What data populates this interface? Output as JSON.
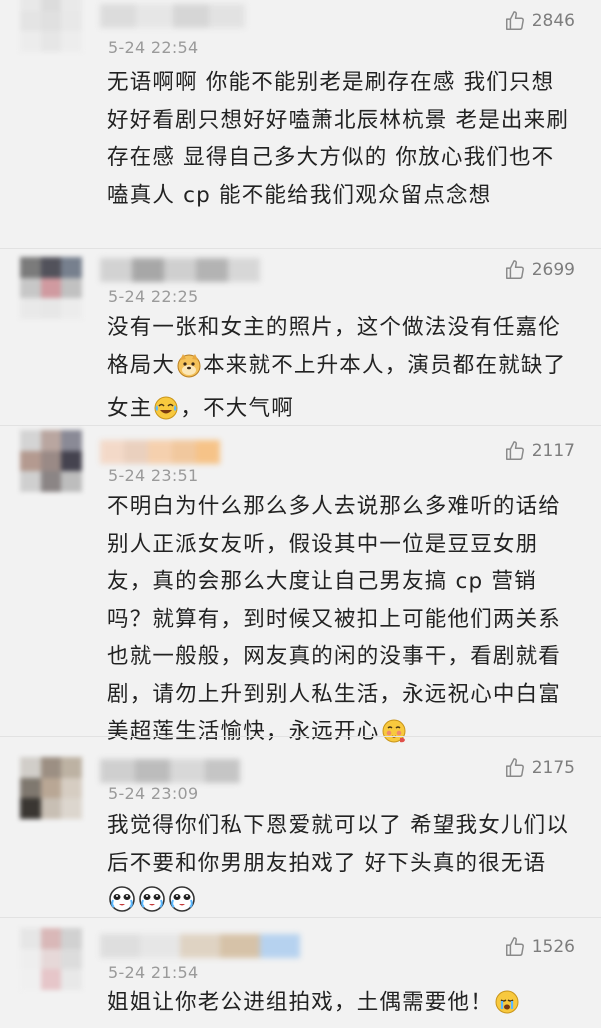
{
  "comments": [
    {
      "time": "5-24 22:54",
      "likes": "2846",
      "text": "无语啊啊 你能不能别老是刷存在感  我们只想好好看剧只想好好嗑萧北辰林杭景 老是出来刷存在感 显得自己多大方似的 你放心我们也不嗑真人 cp  能不能给我们观众留点念想",
      "avatar_colors": [
        "#e8e8e8",
        "#dcdcdc",
        "#e9e9e9",
        "#e4e4e4",
        "#e0e0e0",
        "#e8e8e8",
        "#ececec",
        "#e6e6e6",
        "#ededed"
      ],
      "name_colors": [
        "#dcdcdc",
        "#e6e6e6",
        "#d6d6d6",
        "#e2e2e2"
      ]
    },
    {
      "time": "5-24 22:25",
      "likes": "2699",
      "text_parts": [
        "没有一张和女主的照片，这个做法没有任嘉伦格局大",
        "本来就不上升本人，演员都在就缺了女主",
        "，不大气啊"
      ],
      "avatar_colors": [
        "#7b7b7b",
        "#52525b",
        "#77808e",
        "#c7c7c7",
        "#d09aa0",
        "#c1c1c1",
        "#e9e9e9",
        "#e7e7e7",
        "#ececec"
      ],
      "name_colors": [
        "#d2d2d2",
        "#a7a7a7",
        "#cfcfcf",
        "#b3b3b3",
        "#d7d7d7"
      ]
    },
    {
      "time": "5-24 23:51",
      "likes": "2117",
      "text_parts": [
        "不明白为什么那么多人去说那么多难听的话给别人正派女友听，假设其中一位是豆豆女朋友，真的会那么大度让自己男友搞 cp 营销吗？就算有，到时候又被扣上可能他们两关系也就一般般，网友真的闲的没事干，看剧就看剧，请勿上升到别人私生活，永远祝心中白富美超莲生活愉快，永远开心"
      ],
      "avatar_colors": [
        "#d4d4d4",
        "#b9a6a0",
        "#8a8a96",
        "#b49a90",
        "#9a8a86",
        "#45434f",
        "#cfcfcf",
        "#8b8585",
        "#bdbdbd"
      ],
      "name_colors": [
        "#f3d9c8",
        "#ead0be",
        "#f5d0ae",
        "#f1c89e",
        "#f6c388"
      ]
    },
    {
      "time": "5-24 23:09",
      "likes": "2175",
      "text": "我觉得你们私下恩爱就可以了 希望我女儿们以后不要和你男朋友拍戏了 好下头真的很无语",
      "avatar_colors": [
        "#d1cec9",
        "#9c8f83",
        "#bdb2a3",
        "#7f786f",
        "#b9a795",
        "#d6cdc2",
        "#3a3632",
        "#c8bfb4",
        "#dcd6ce"
      ],
      "name_colors": [
        "#cfcfcf",
        "#bcbcbc",
        "#d8d8d8",
        "#c5c5c5"
      ]
    },
    {
      "time": "5-24 21:54",
      "likes": "1526",
      "text_parts": [
        "姐姐让你老公进组拍戏，土偶需要他！"
      ],
      "avatar_colors": [
        "#e6e6e6",
        "#d9b8b8",
        "#d1d1d1",
        "#eeeeee",
        "#e6d8d8",
        "#dcdcdc",
        "#f0f0f0",
        "#e6c6c9",
        "#e8e8e8"
      ],
      "name_colors": [
        "#dedede",
        "#e6e6e6",
        "#dfd3c3",
        "#d6c2a8",
        "#b6d2ef"
      ]
    }
  ]
}
